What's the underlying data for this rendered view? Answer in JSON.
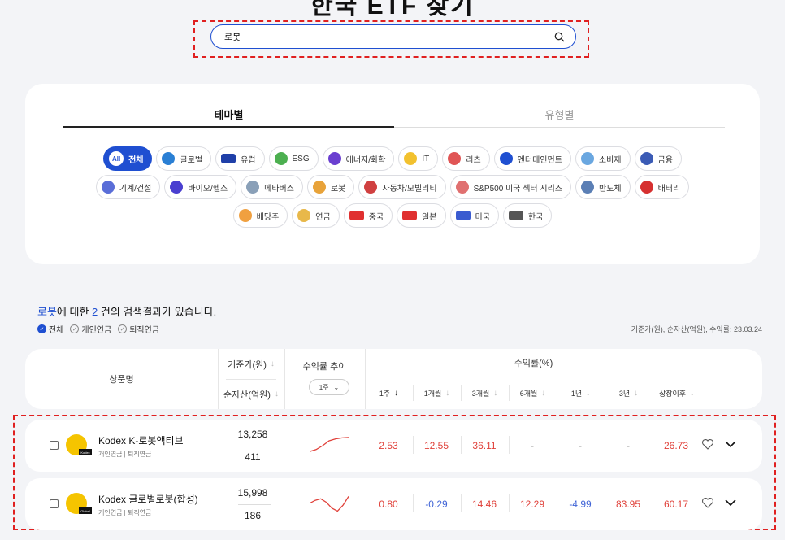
{
  "page": {
    "title": "한국 ETF 찾기"
  },
  "search": {
    "value": "로봇",
    "placeholder": ""
  },
  "tabs": [
    {
      "label": "테마별",
      "active": true
    },
    {
      "label": "유형별",
      "active": false
    }
  ],
  "themes": [
    [
      {
        "label": "전체",
        "icon": "all-icon",
        "badge": "All",
        "active": true
      },
      {
        "label": "글로벌",
        "icon": "globe-icon"
      },
      {
        "label": "유럽",
        "icon": "eu-flag-icon"
      },
      {
        "label": "ESG",
        "icon": "leaf-icon"
      },
      {
        "label": "에너지/화학",
        "icon": "energy-icon"
      },
      {
        "label": "IT",
        "icon": "bulb-icon"
      },
      {
        "label": "리츠",
        "icon": "building-icon"
      },
      {
        "label": "엔터테인먼트",
        "icon": "play-icon"
      },
      {
        "label": "소비재",
        "icon": "cart-icon"
      },
      {
        "label": "금융",
        "icon": "money-bag-icon"
      }
    ],
    [
      {
        "label": "기계/건설",
        "icon": "construction-icon"
      },
      {
        "label": "바이오/헬스",
        "icon": "dna-icon"
      },
      {
        "label": "메타버스",
        "icon": "vr-icon"
      },
      {
        "label": "로봇",
        "icon": "robot-arm-icon"
      },
      {
        "label": "자동차/모빌리티",
        "icon": "car-icon"
      },
      {
        "label": "S&P500 미국 섹터 시리즈",
        "icon": "sector-grid-icon"
      },
      {
        "label": "반도체",
        "icon": "chip-icon"
      },
      {
        "label": "배터리",
        "icon": "battery-icon"
      }
    ],
    [
      {
        "label": "배당주",
        "icon": "calendar-icon"
      },
      {
        "label": "연금",
        "icon": "coin-icon"
      },
      {
        "label": "중국",
        "icon": "china-flag-icon"
      },
      {
        "label": "일본",
        "icon": "japan-flag-icon"
      },
      {
        "label": "미국",
        "icon": "us-flag-icon"
      },
      {
        "label": "한국",
        "icon": "korea-flag-icon"
      }
    ]
  ],
  "results": {
    "keyword": "로봇",
    "text_mid": "에 대한 ",
    "count": "2",
    "text_end": " 건의 검색결과가 있습니다.",
    "filters": [
      {
        "label": "전체",
        "checked": true
      },
      {
        "label": "개인연금",
        "checked": false
      },
      {
        "label": "퇴직연금",
        "checked": false
      }
    ],
    "note": "기준가(원), 순자산(억원), 수익률: 23.03.24"
  },
  "table": {
    "product_header": "상품명",
    "nav_header": "기준가(원)",
    "aum_header": "순자산(억원)",
    "trend_header": "수익률 추이",
    "trend_period": "1주",
    "returns_header": "수익률(%)",
    "periods": [
      "1주",
      "1개월",
      "3개월",
      "6개월",
      "1년",
      "3년",
      "상장이후"
    ]
  },
  "rows": [
    {
      "name": "Kodex K-로봇액티브",
      "pension": "개인연금 | 퇴직연금",
      "price": "13,258",
      "aum": "411",
      "returns": [
        "2.53",
        "12.55",
        "36.11",
        "-",
        "-",
        "-",
        "26.73"
      ],
      "logo_tag": "Kodex",
      "trend": [
        0.2,
        0.3,
        0.5,
        0.75,
        0.85,
        0.9,
        0.92
      ]
    },
    {
      "name": "Kodex 글로벌로봇(합성)",
      "pension": "개인연금 | 퇴직연금",
      "price": "15,998",
      "aum": "186",
      "returns": [
        "0.80",
        "-0.29",
        "14.46",
        "12.29",
        "-4.99",
        "83.95",
        "60.17"
      ],
      "logo_tag": "Global",
      "trend": [
        0.55,
        0.7,
        0.78,
        0.6,
        0.3,
        0.15,
        0.45,
        0.9
      ]
    }
  ],
  "colors": {
    "accent": "#1f4fd1",
    "positive": "#e0413a",
    "negative": "#3f63d6",
    "highlight": "#e02020"
  }
}
